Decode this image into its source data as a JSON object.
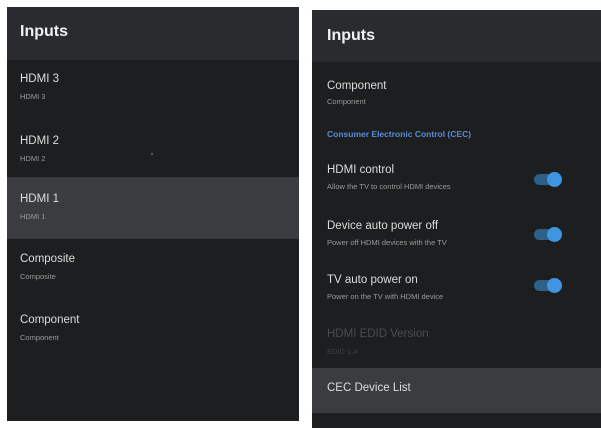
{
  "left": {
    "title": "Inputs",
    "items": [
      {
        "title": "HDMI 3",
        "subtitle": "HDMI 3"
      },
      {
        "title": "HDMI 2",
        "subtitle": "HDMI 2"
      },
      {
        "title": "HDMI 1",
        "subtitle": "HDMI 1"
      },
      {
        "title": "Composite",
        "subtitle": "Composite"
      },
      {
        "title": "Component",
        "subtitle": "Component"
      }
    ]
  },
  "right": {
    "title": "Inputs",
    "component": {
      "title": "Component",
      "subtitle": "Component"
    },
    "section_label": "Consumer Electronic Control (CEC)",
    "hdmi_control": {
      "title": "HDMI control",
      "subtitle": "Allow the TV to control HDMI devices",
      "enabled": true
    },
    "device_auto_power_off": {
      "title": "Device auto power off",
      "subtitle": "Power off HDMI devices with the TV",
      "enabled": true
    },
    "tv_auto_power_on": {
      "title": "TV auto power on",
      "subtitle": "Power on the TV with HDMI device",
      "enabled": true
    },
    "edid_version": {
      "title": "HDMI EDID Version",
      "subtitle": "EDID 1.4"
    },
    "cec_device_list": {
      "title": "CEC Device List"
    }
  },
  "colors": {
    "panel_bg": "#1d1e20",
    "header_bg": "#2a2b2e",
    "selected_bg": "#3a3c3f",
    "accent": "#3f95df",
    "section_label": "#5d8ad6"
  }
}
